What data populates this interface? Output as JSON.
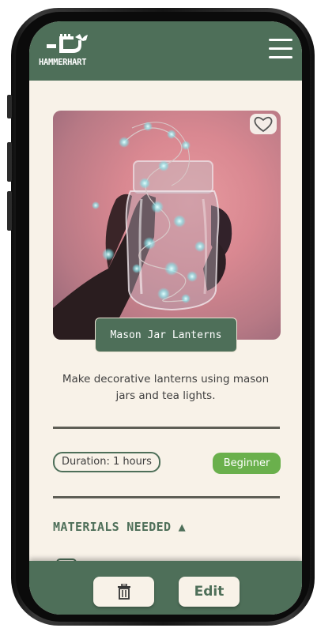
{
  "brand": {
    "name": "HAMMERHART",
    "logo_icon": "hammer-hand-logo"
  },
  "header": {
    "menu_icon": "hamburger-menu-icon"
  },
  "project": {
    "title": "Mason Jar Lanterns",
    "description": "Make decorative lanterns using mason jars and tea lights.",
    "duration": "Duration: 1 hours",
    "level": "Beginner",
    "favorite_icon": "heart-outline-icon",
    "image_subject": "hand-holding-jar-with-string-lights"
  },
  "materials": {
    "heading": "MATERIALS NEEDED ▲"
  },
  "actions": {
    "delete_icon": "trash-icon",
    "edit_label": "Edit"
  },
  "colors": {
    "primary": "#4e6f59",
    "background": "#f8f2e8",
    "level_badge": "#6ab04c",
    "divider": "#5e5e55"
  }
}
